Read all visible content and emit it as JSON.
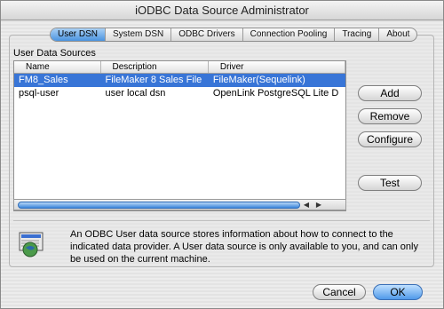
{
  "window": {
    "title": "iODBC Data Source Administrator"
  },
  "tabs": [
    {
      "label": "User DSN",
      "active": true
    },
    {
      "label": "System DSN",
      "active": false
    },
    {
      "label": "ODBC Drivers",
      "active": false
    },
    {
      "label": "Connection Pooling",
      "active": false
    },
    {
      "label": "Tracing",
      "active": false
    },
    {
      "label": "About",
      "active": false
    }
  ],
  "user_dsn": {
    "section_label": "User Data Sources",
    "columns": [
      "Name",
      "Description",
      "Driver"
    ],
    "rows": [
      {
        "name": "FM8_Sales",
        "description": "FileMaker 8 Sales File",
        "driver": "FileMaker(Sequelink)",
        "selected": true
      },
      {
        "name": "psql-user",
        "description": "user local dsn",
        "driver": "OpenLink PostgreSQL Lite D",
        "selected": false
      }
    ]
  },
  "buttons": {
    "add": "Add",
    "remove": "Remove",
    "configure": "Configure",
    "test": "Test",
    "cancel": "Cancel",
    "ok": "OK"
  },
  "info": {
    "icon": "database-globe-icon",
    "text": "An ODBC User data source stores information about how to connect to the indicated data provider. A User data source is only available to you, and can only be used on the current machine."
  },
  "colors": {
    "selection": "#3875d7",
    "accent": "#4f9aea"
  }
}
